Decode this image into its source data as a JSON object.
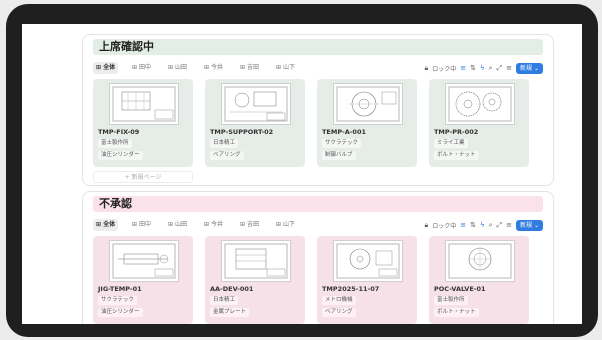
{
  "sections": [
    {
      "title": "上席確認中",
      "tabs": [
        "全体",
        "田中",
        "山田",
        "今井",
        "吉田",
        "山下"
      ],
      "lock_label": "ロック中",
      "new_label": "新規",
      "add_page_label": "+ 新規ページ",
      "cards": [
        {
          "name": "TMP-FIX-09",
          "tag1": "富士製作所",
          "tag2": "油圧シリンダー"
        },
        {
          "name": "TMP-SUPPORT-02",
          "tag1": "日本精工",
          "tag2": "ベアリング"
        },
        {
          "name": "TEMP-A-001",
          "tag1": "サクラテック",
          "tag2": "制御バルブ"
        },
        {
          "name": "TMP-PR-002",
          "tag1": "ミライ工業",
          "tag2": "ボルト・ナット"
        }
      ]
    },
    {
      "title": "不承認",
      "tabs": [
        "全体",
        "田中",
        "山田",
        "今井",
        "吉田",
        "山下"
      ],
      "lock_label": "ロック中",
      "new_label": "新規",
      "cards": [
        {
          "name": "JIG-TEMP-01",
          "tag1": "サクラテック",
          "tag2": "油圧シリンダー"
        },
        {
          "name": "AA-DEV-001",
          "tag1": "日本精工",
          "tag2": "金属プレート"
        },
        {
          "name": "TMP2025-11-07",
          "tag1": "メトロ機械",
          "tag2": "ベアリング"
        },
        {
          "name": "POC-VALVE-01",
          "tag1": "富士製作所",
          "tag2": "ボルト・ナット"
        }
      ]
    }
  ],
  "icons": {
    "tab": "grid-icon",
    "lock": "lock-icon",
    "filter": "filter-icon",
    "sort": "sort-icon",
    "lightning": "lightning-icon",
    "search": "search-icon",
    "expand": "expand-icon",
    "settings": "sliders-icon",
    "chevron": "chevron-down-icon"
  },
  "colors": {
    "accent": "#2f7de1",
    "review_header": "#e3eee6",
    "rejected_header": "#fbe1ea"
  }
}
